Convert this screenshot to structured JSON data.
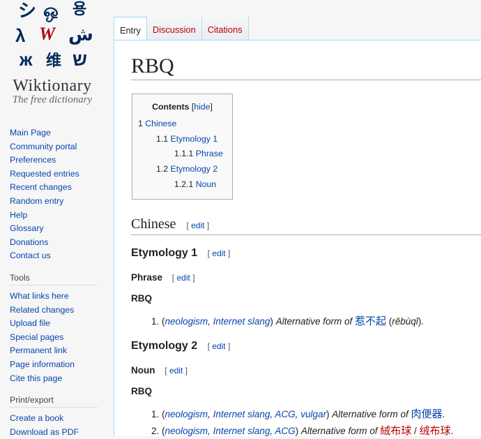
{
  "logo": {
    "wordmark": "Wiktionary",
    "tagline": "The free dictionary"
  },
  "sidebar": {
    "navigation": [
      "Main Page",
      "Community portal",
      "Preferences",
      "Requested entries",
      "Recent changes",
      "Random entry",
      "Help",
      "Glossary",
      "Donations",
      "Contact us"
    ],
    "tools_heading": "Tools",
    "tools": [
      "What links here",
      "Related changes",
      "Upload file",
      "Special pages",
      "Permanent link",
      "Page information",
      "Cite this page"
    ],
    "print_heading": "Print/export",
    "print": [
      "Create a book",
      "Download as PDF"
    ]
  },
  "tabs": [
    {
      "label": "Entry",
      "selected": true
    },
    {
      "label": "Discussion",
      "selected": false
    },
    {
      "label": "Citations",
      "selected": false
    }
  ],
  "page": {
    "title": "RBQ"
  },
  "toc": {
    "title": "Contents",
    "hide_open": "[",
    "hide_label": "hide",
    "hide_close": "]",
    "items": [
      {
        "number": "1",
        "label": "Chinese"
      },
      {
        "number": "1.1",
        "label": "Etymology 1"
      },
      {
        "number": "1.1.1",
        "label": "Phrase"
      },
      {
        "number": "1.2",
        "label": "Etymology 2"
      },
      {
        "number": "1.2.1",
        "label": "Noun"
      }
    ]
  },
  "edit": {
    "open": "[",
    "label": "edit",
    "close": "]"
  },
  "sections": {
    "chinese": "Chinese",
    "etymology1": "Etymology 1",
    "phrase": "Phrase",
    "etymology2": "Etymology 2",
    "noun": "Noun"
  },
  "entry1": {
    "headword": "RBQ",
    "sense1": {
      "number": "1.",
      "open_paren": "(",
      "tag1": "neologism",
      "comma": ",",
      "tag2": "Internet slang",
      "close_paren": ")",
      "text": "Alternative form of",
      "target": "惹不起",
      "pinyin_open": "(",
      "pinyin": "rěbùqǐ",
      "pinyin_close": ").",
      "end": ""
    }
  },
  "entry2": {
    "headword": "RBQ",
    "sense1": {
      "number": "1.",
      "tags": [
        "neologism",
        "Internet slang",
        "ACG",
        "vulgar"
      ],
      "text": "Alternative form of",
      "target": "肉便器",
      "end": "."
    },
    "sense2": {
      "number": "2.",
      "tags": [
        "neologism",
        "Internet slang",
        "ACG"
      ],
      "text": "Alternative form of",
      "target1": "絨布球",
      "slash": "/",
      "target2": "绒布球",
      "end": "."
    }
  },
  "colors": {
    "link": "#0645ad",
    "redlink": "#ba0000",
    "logo_red": "#b5001e",
    "logo_blue": "#00285a"
  }
}
